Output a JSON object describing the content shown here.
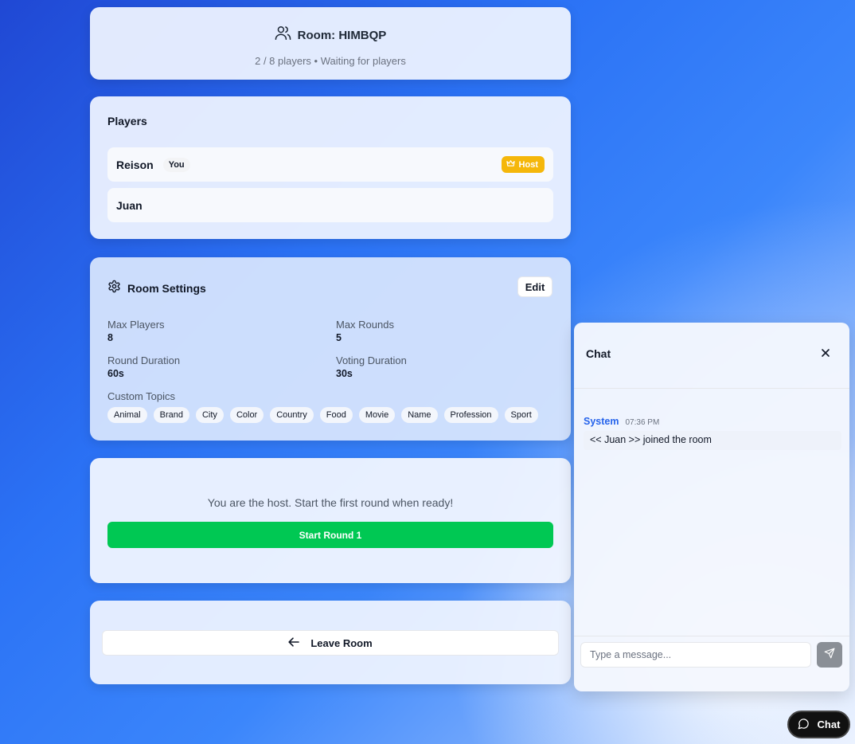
{
  "room": {
    "title": "Room: HIMBQP",
    "subtitle": "2 / 8 players • Waiting for players"
  },
  "players": {
    "heading": "Players",
    "list": [
      {
        "name": "Reison",
        "you_badge": "You",
        "host_badge": "Host"
      },
      {
        "name": "Juan"
      }
    ]
  },
  "settings": {
    "heading": "Room Settings",
    "edit_label": "Edit",
    "max_players_label": "Max Players",
    "max_players_value": "8",
    "max_rounds_label": "Max Rounds",
    "max_rounds_value": "5",
    "round_duration_label": "Round Duration",
    "round_duration_value": "60s",
    "voting_duration_label": "Voting Duration",
    "voting_duration_value": "30s",
    "topics_label": "Custom Topics",
    "topics": [
      "Animal",
      "Brand",
      "City",
      "Color",
      "Country",
      "Food",
      "Movie",
      "Name",
      "Profession",
      "Sport"
    ]
  },
  "start": {
    "message": "You are the host. Start the first round when ready!",
    "button_label": "Start Round 1"
  },
  "leave": {
    "button_label": "Leave Room"
  },
  "chat": {
    "title": "Chat",
    "messages": [
      {
        "sender": "System",
        "time": "07:36 PM",
        "text": "<< Juan >> joined the room"
      }
    ],
    "input_placeholder": "Type a message...",
    "toggle_label": "Chat"
  },
  "colors": {
    "start_button": "#00c853",
    "host_badge": "#f5b70a",
    "system_sender": "#2563eb"
  }
}
